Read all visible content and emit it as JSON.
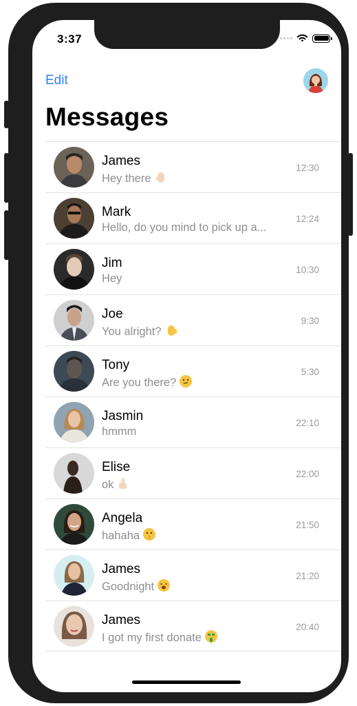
{
  "status": {
    "time": "3:37"
  },
  "nav": {
    "edit_label": "Edit",
    "title": "Messages"
  },
  "conversations": [
    {
      "name": "James",
      "message": "Hey there",
      "time": "12:30",
      "emoji": "raised-back-hand"
    },
    {
      "name": "Mark",
      "message": "Hello, do you mind to pick up a...",
      "time": "12:24",
      "emoji": ""
    },
    {
      "name": "Jim",
      "message": "Hey",
      "time": "10:30",
      "emoji": ""
    },
    {
      "name": "Joe",
      "message": "You alright?",
      "time": "9:30",
      "emoji": "raised-hand"
    },
    {
      "name": "Tony",
      "message": "Are you there?",
      "time": "5:30",
      "emoji": "thinking-face"
    },
    {
      "name": "Jasmin",
      "message": "hmmm",
      "time": "22:10",
      "emoji": ""
    },
    {
      "name": "Elise",
      "message": "ok",
      "time": "22:00",
      "emoji": "thumbs-up"
    },
    {
      "name": "Angela",
      "message": "hahaha",
      "time": "21:50",
      "emoji": "shushing-face"
    },
    {
      "name": "James",
      "message": "Goodnight",
      "time": "21:20",
      "emoji": "yawning-face"
    },
    {
      "name": "James",
      "message": "I got my first donate",
      "time": "20:40",
      "emoji": "money-mouth-face"
    }
  ],
  "colors": {
    "accent": "#2f7ff3",
    "secondary_text": "#8e8e93",
    "frame": "#1e1e1e"
  }
}
